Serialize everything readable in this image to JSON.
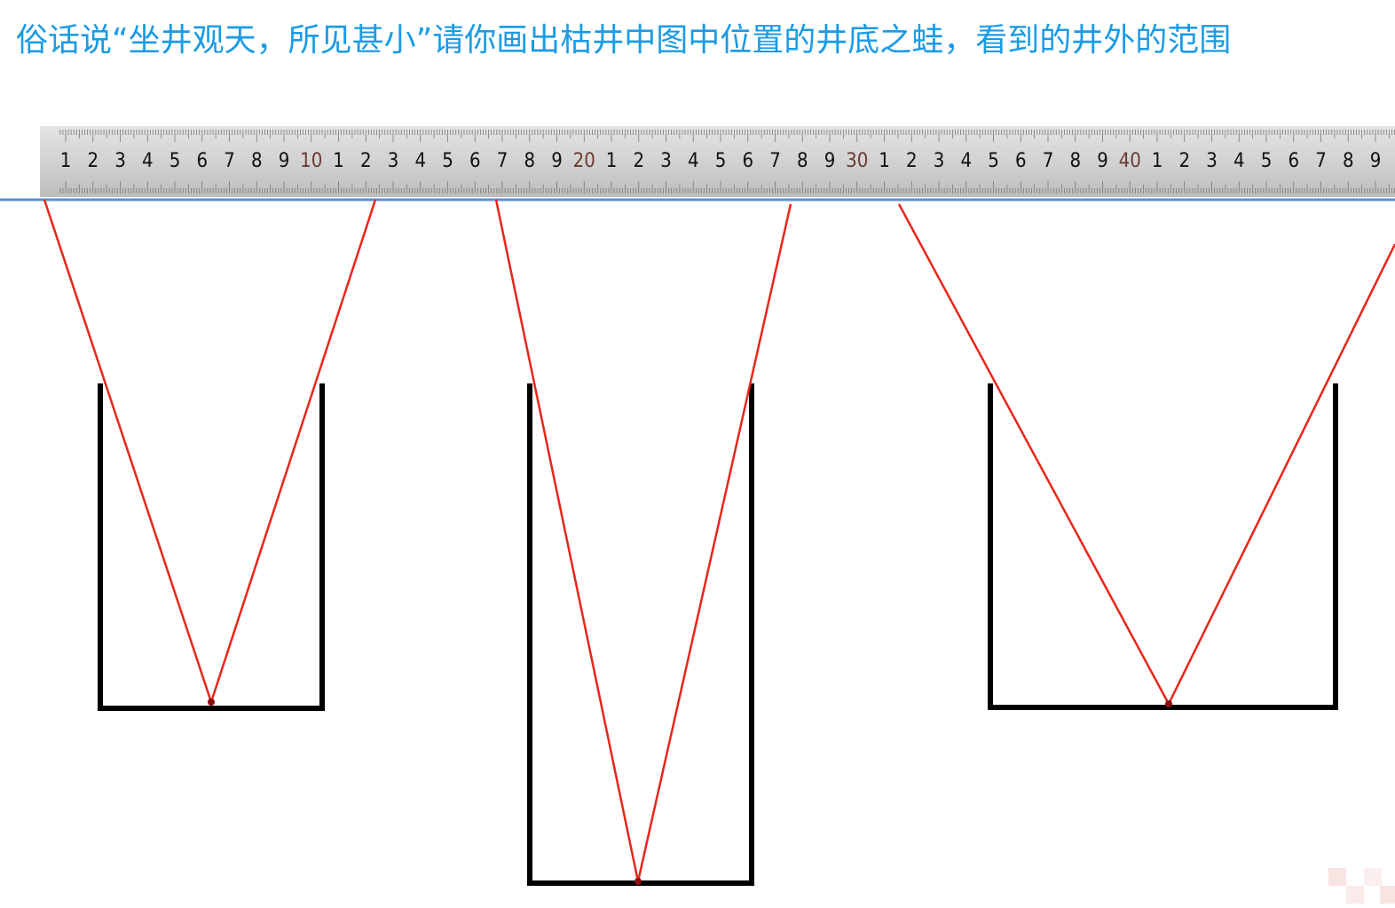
{
  "title": "俗话说“坐井观天，所见甚小”请你画出枯井中图中位置的井底之蛙，看到的井外的范围",
  "ruler": {
    "labels": [
      "1",
      "2",
      "3",
      "4",
      "5",
      "6",
      "7",
      "8",
      "9",
      "10",
      "1",
      "2",
      "3",
      "4",
      "5",
      "6",
      "7",
      "8",
      "9",
      "20",
      "1",
      "2",
      "3",
      "4",
      "5",
      "6",
      "7",
      "8",
      "9",
      "30",
      "1",
      "2",
      "3",
      "4",
      "5",
      "6",
      "7",
      "8",
      "9",
      "40",
      "1",
      "2",
      "3",
      "4",
      "5",
      "6",
      "7",
      "8",
      "9"
    ]
  },
  "colors": {
    "title": "#1a9be6",
    "sight_line": "#e8261a",
    "well": "#000000",
    "baseline": "#5b8fd0"
  }
}
